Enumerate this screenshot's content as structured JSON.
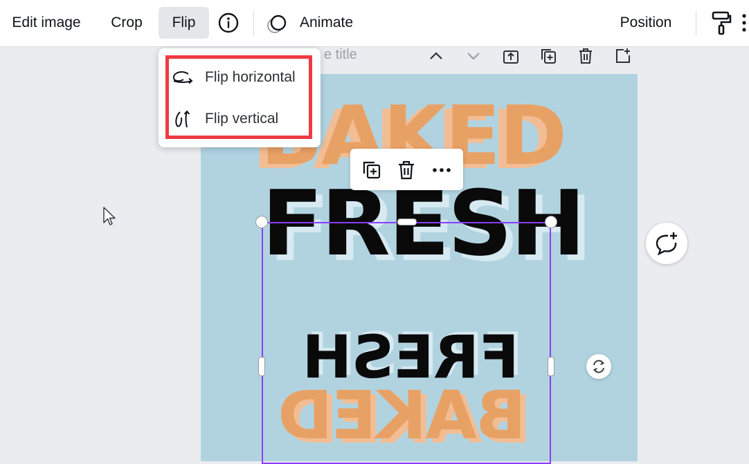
{
  "toolbar": {
    "edit_image": "Edit image",
    "crop": "Crop",
    "flip": "Flip",
    "animate": "Animate",
    "position": "Position"
  },
  "page": {
    "title_placeholder": "e title"
  },
  "flip_menu": {
    "items": [
      {
        "label": "Flip horizontal",
        "icon": "flip-horizontal-icon"
      },
      {
        "label": "Flip vertical",
        "icon": "flip-vertical-icon"
      }
    ]
  },
  "design": {
    "top_word": "BAKED",
    "middle_word": "FRESH",
    "flipped_word_1": "FRESH",
    "flipped_word_2": "BAKED",
    "background_color": "#b1d3e0",
    "orange_color": "#e8a165",
    "black_color": "#0a0a0a"
  },
  "colors": {
    "accent_selection": "#8b3dff",
    "highlight_box": "#ef3b43"
  }
}
